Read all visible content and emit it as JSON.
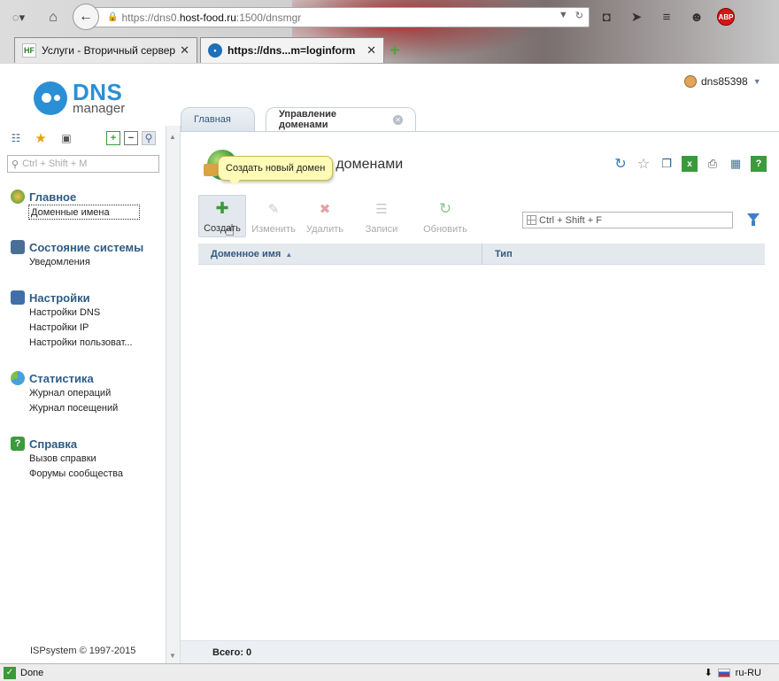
{
  "browser": {
    "url_prefix": "https://dns0.",
    "url_host": "host-food.ru",
    "url_suffix": ":1500/dnsmgr",
    "tabs": [
      {
        "favicon": "HF",
        "title": "Услуги - Вторичный сервер..."
      },
      {
        "favicon": "•",
        "title": "https://dns...m=loginform"
      }
    ],
    "new_tab": "+",
    "abp_label": "ABP"
  },
  "app": {
    "logo_main": "DNS",
    "logo_sub": "manager",
    "user_name": "dns85398"
  },
  "sidebar": {
    "search_placeholder": "Ctrl + Shift + M",
    "groups": [
      {
        "title": "Главное",
        "color": "#e0a236",
        "items": [
          "Доменные имена"
        ]
      },
      {
        "title": "Состояние системы",
        "color": "#4a6f96",
        "items": [
          "Уведомления"
        ]
      },
      {
        "title": "Настройки",
        "color": "#3f6fa8",
        "items": [
          "Настройки DNS",
          "Настройки IP",
          "Настройки пользоват..."
        ]
      },
      {
        "title": "Статистика",
        "color": "#4aa0d8",
        "items": [
          "Журнал операций",
          "Журнал посещений"
        ]
      },
      {
        "title": "Справка",
        "color": "#3d9a3d",
        "items": [
          "Вызов справки",
          "Форумы сообщества"
        ]
      }
    ],
    "copyright": "ISPsystem © 1997-2015"
  },
  "main": {
    "tabs": [
      {
        "label": "Главная"
      },
      {
        "label": "Управление доменами"
      }
    ],
    "title": "е доменами",
    "tooltip": "Создать новый домен",
    "toolbar": {
      "create": "Создать",
      "edit": "Изменить",
      "delete": "Удалить",
      "records": "Записи",
      "refresh": "Обновить"
    },
    "filter_placeholder": "Ctrl + Shift + F",
    "columns": [
      "Доменное имя",
      "Тип"
    ],
    "rows": [],
    "footer_total": "Всего: 0"
  },
  "status": {
    "text": "Done",
    "locale": "ru-RU"
  },
  "colors": {
    "accent": "#2b8fd6",
    "link": "#2e5b86",
    "tooltip_bg": "#fffab5"
  }
}
